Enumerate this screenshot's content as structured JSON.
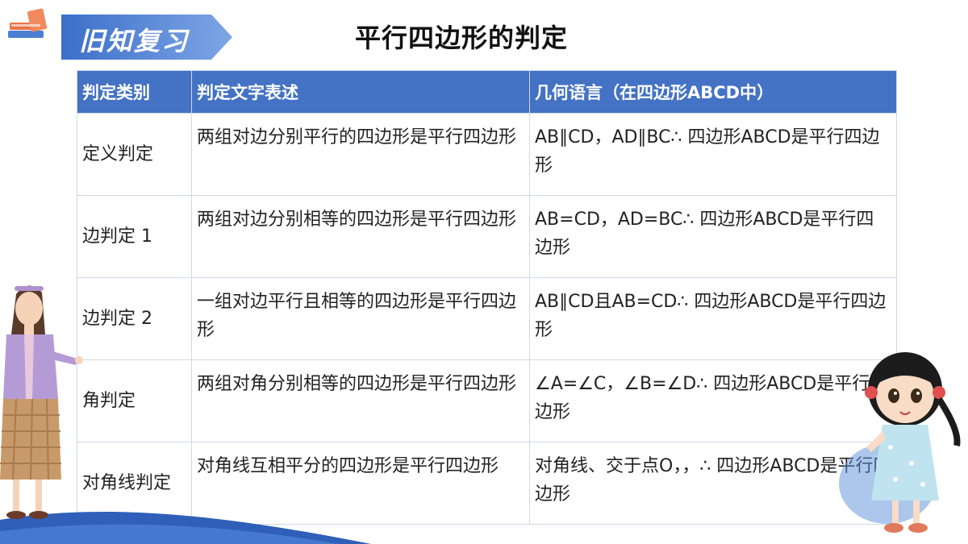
{
  "header": {
    "section_badge": "旧知复习",
    "title": "平行四边形的判定"
  },
  "table": {
    "headers": [
      "判定类别",
      "判定文字表述",
      "几何语言（在四边形ABCD中）"
    ],
    "rows": [
      {
        "category": "定义判定",
        "statement": "两组对边分别平行的四边形是平行四边形",
        "geometry": "AB∥CD，AD∥BC∴ 四边形ABCD是平行四边形"
      },
      {
        "category": "边判定 1",
        "statement": "两组对边分别相等的四边形是平行四边形",
        "geometry": "AB=CD，AD=BC∴ 四边形ABCD是平行四边形"
      },
      {
        "category": "边判定 2",
        "statement": "一组对边平行且相等的四边形是平行四边形",
        "geometry": "AB∥CD且AB=CD∴ 四边形ABCD是平行四边形"
      },
      {
        "category": "角判定",
        "statement": "两组对角分别相等的四边形是平行四边形",
        "geometry": "∠A=∠C，∠B=∠D∴ 四边形ABCD是平行四边形"
      },
      {
        "category": "对角线判定",
        "statement": "对角线互相平分的四边形是平行四边形",
        "geometry": "对角线、交于点O，，∴ 四边形ABCD是平行四边形"
      }
    ]
  },
  "colors": {
    "header_bg": "#4472c4",
    "banner": "#4a7fd4",
    "border": "#cfd8ea"
  }
}
